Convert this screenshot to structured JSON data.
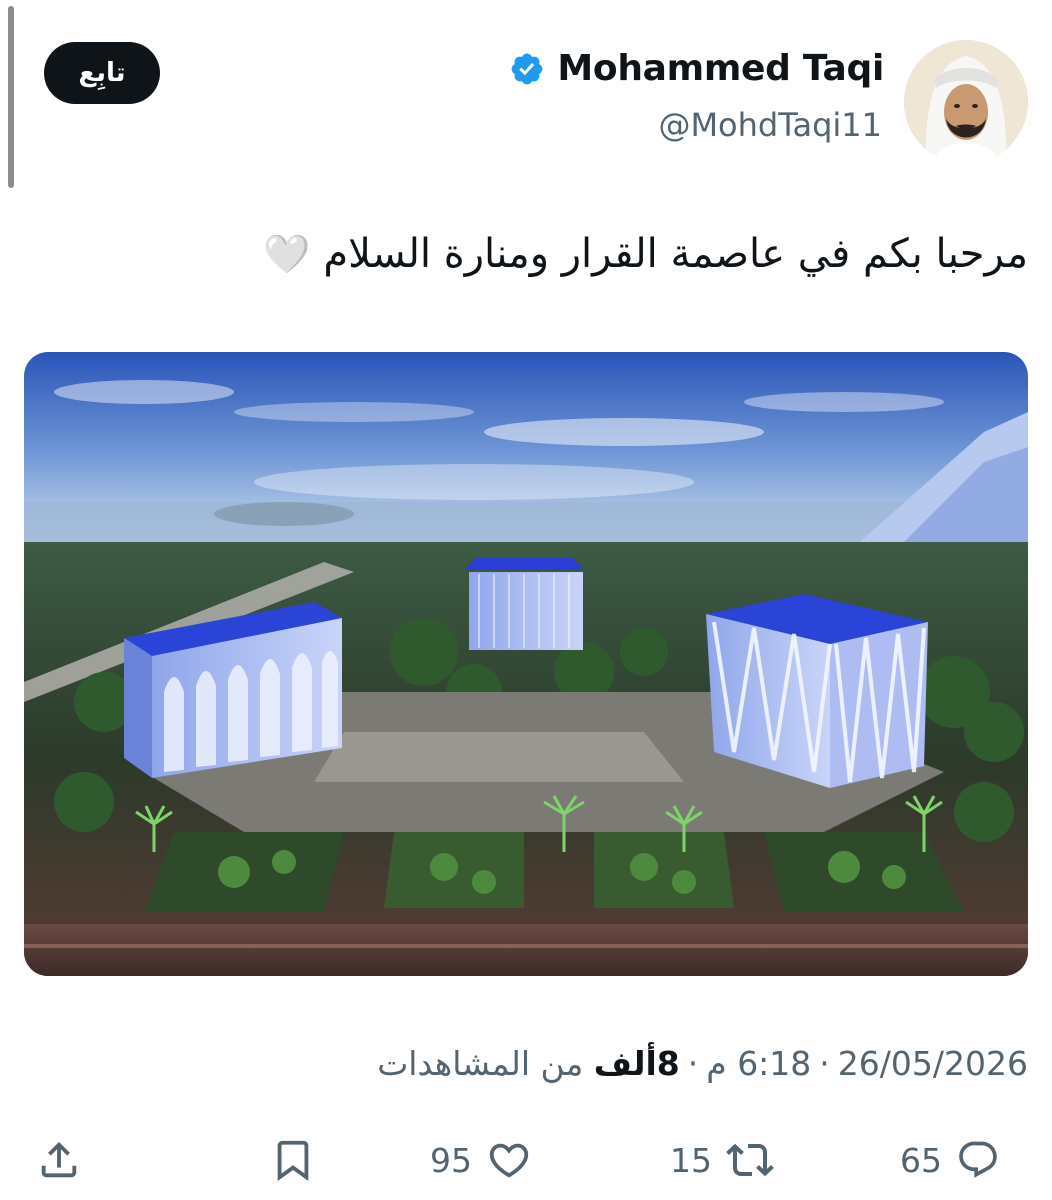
{
  "header": {
    "display_name": "Mohammed Taqi",
    "handle": "@MohdTaqi11",
    "follow_label": "تابِع",
    "verified": true
  },
  "tweet": {
    "text": "مرحبا بكم في عاصمة القرار ومنارة السلام",
    "emoji": "🤍"
  },
  "meta": {
    "date": "26/05/2026",
    "time": "6:18 م",
    "views_count": "8ألف",
    "views_label": "من المشاهدات",
    "separator": "·"
  },
  "actions": {
    "replies": "65",
    "retweets": "15",
    "likes": "95"
  },
  "icons": {
    "verified": "verified-badge-icon",
    "reply": "reply-icon",
    "retweet": "retweet-icon",
    "like": "heart-icon",
    "bookmark": "bookmark-icon",
    "share": "share-icon"
  },
  "colors": {
    "text_primary": "#0f1419",
    "text_secondary": "#536471",
    "verified_blue": "#1d9bf0",
    "follow_bg": "#0f1419"
  }
}
